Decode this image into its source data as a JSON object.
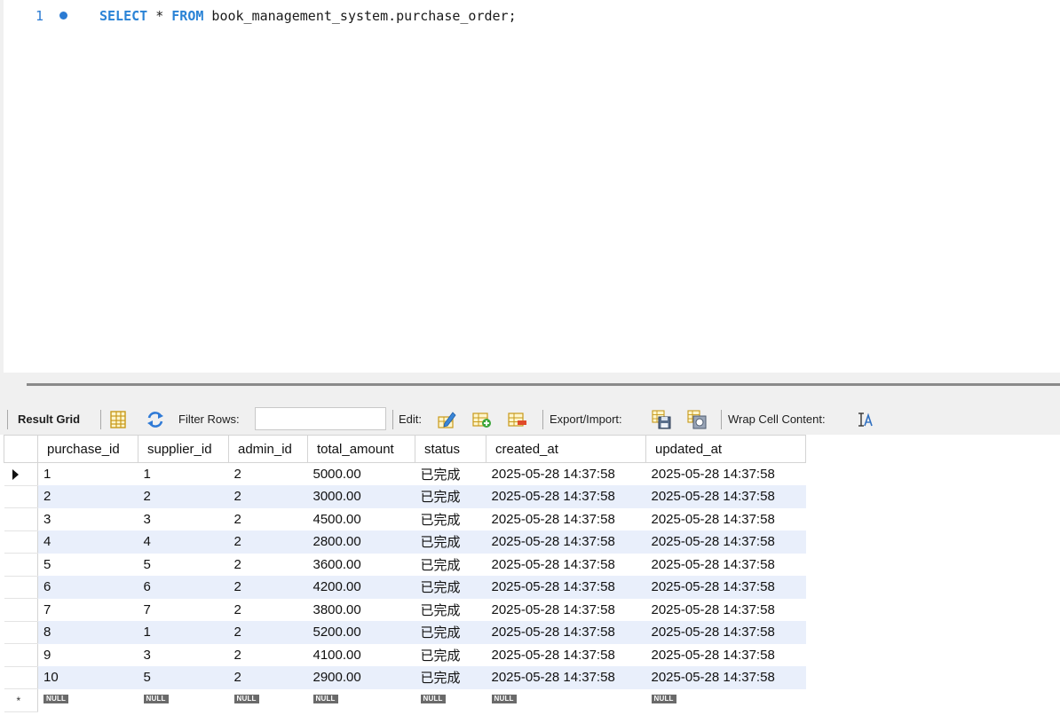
{
  "editor": {
    "line_number": "1",
    "sql": {
      "kw_select": "SELECT",
      "star": " * ",
      "kw_from": "FROM",
      "rest": " book_management_system.purchase_order;"
    }
  },
  "toolbar": {
    "result_grid_label": "Result Grid",
    "filter_rows_label": "Filter Rows:",
    "filter_rows_value": "",
    "edit_label": "Edit:",
    "export_import_label": "Export/Import:",
    "wrap_cell_label": "Wrap Cell Content:"
  },
  "grid": {
    "columns": [
      "purchase_id",
      "supplier_id",
      "admin_id",
      "total_amount",
      "status",
      "created_at",
      "updated_at"
    ],
    "rows": [
      [
        "1",
        "1",
        "2",
        "5000.00",
        "已完成",
        "2025-05-28 14:37:58",
        "2025-05-28 14:37:58"
      ],
      [
        "2",
        "2",
        "2",
        "3000.00",
        "已完成",
        "2025-05-28 14:37:58",
        "2025-05-28 14:37:58"
      ],
      [
        "3",
        "3",
        "2",
        "4500.00",
        "已完成",
        "2025-05-28 14:37:58",
        "2025-05-28 14:37:58"
      ],
      [
        "4",
        "4",
        "2",
        "2800.00",
        "已完成",
        "2025-05-28 14:37:58",
        "2025-05-28 14:37:58"
      ],
      [
        "5",
        "5",
        "2",
        "3600.00",
        "已完成",
        "2025-05-28 14:37:58",
        "2025-05-28 14:37:58"
      ],
      [
        "6",
        "6",
        "2",
        "4200.00",
        "已完成",
        "2025-05-28 14:37:58",
        "2025-05-28 14:37:58"
      ],
      [
        "7",
        "7",
        "2",
        "3800.00",
        "已完成",
        "2025-05-28 14:37:58",
        "2025-05-28 14:37:58"
      ],
      [
        "8",
        "1",
        "2",
        "5200.00",
        "已完成",
        "2025-05-28 14:37:58",
        "2025-05-28 14:37:58"
      ],
      [
        "9",
        "3",
        "2",
        "4100.00",
        "已完成",
        "2025-05-28 14:37:58",
        "2025-05-28 14:37:58"
      ],
      [
        "10",
        "5",
        "2",
        "2900.00",
        "已完成",
        "2025-05-28 14:37:58",
        "2025-05-28 14:37:58"
      ]
    ],
    "null_label": "NULL",
    "new_row_marker": "*"
  },
  "colors": {
    "keyword": "#2a83d6",
    "row_alt": "#e9effb",
    "toolbar_bg": "#f0f0f0"
  },
  "icons": [
    "grid-view-icon",
    "refresh-icon",
    "edit-cell-icon",
    "add-row-icon",
    "delete-row-icon",
    "export-icon",
    "import-icon",
    "wrap-cell-icon"
  ]
}
